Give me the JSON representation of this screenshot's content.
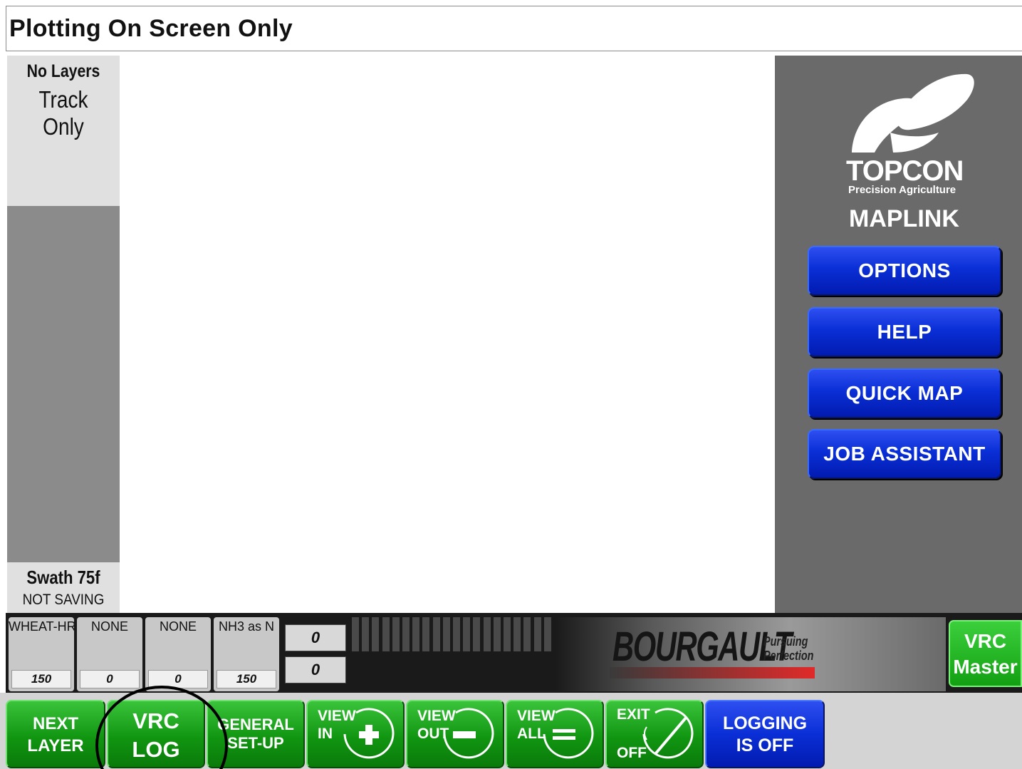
{
  "header": {
    "title": "Plotting On Screen Only"
  },
  "left_panel": {
    "layers": "No Layers",
    "mode": "Track Only",
    "swath": "Swath 75f",
    "saving": "NOT SAVING"
  },
  "right_panel": {
    "brand": "TOPCON",
    "brand_sub": "Precision Agriculture",
    "product": "MAPLINK",
    "buttons": {
      "options": "OPTIONS",
      "help": "HELP",
      "quick_map": "QUICK MAP",
      "job_assistant": "JOB ASSISTANT"
    }
  },
  "products": [
    {
      "name": "WHEAT-HR",
      "rate": "150"
    },
    {
      "name": "NONE",
      "rate": "0"
    },
    {
      "name": "NONE",
      "rate": "0"
    },
    {
      "name": "NH3 as N",
      "rate": "150"
    }
  ],
  "readouts": [
    "0",
    "0"
  ],
  "bourgault": {
    "brand": "BOURGAULT",
    "tag1": "Pursuing",
    "tag2": "Perfection"
  },
  "vrc_master": {
    "l1": "VRC",
    "l2": "Master"
  },
  "bottom_buttons": {
    "next_layer": {
      "l1": "NEXT",
      "l2": "LAYER"
    },
    "vrc_log": {
      "l1": "VRC",
      "l2": "LOG"
    },
    "general_setup": {
      "l1": "GENERAL",
      "l2": "SET-UP"
    },
    "view_in": {
      "l1": "VIEW",
      "l2": "IN"
    },
    "view_out": {
      "l1": "VIEW",
      "l2": "OUT"
    },
    "view_all": {
      "l1": "VIEW",
      "l2": "ALL"
    },
    "exit_off": {
      "l1": "EXIT",
      "l2": "OFF"
    },
    "logging": {
      "l1": "LOGGING",
      "l2": "IS OFF"
    }
  },
  "colors": {
    "accent_blue": "#0a2fd6",
    "accent_green": "#119611",
    "panel_gray": "#6a6a6a"
  },
  "icons": [
    "topcon-logo-icon",
    "zoom-in-icon",
    "zoom-out-icon",
    "zoom-all-icon",
    "power-off-icon"
  ]
}
